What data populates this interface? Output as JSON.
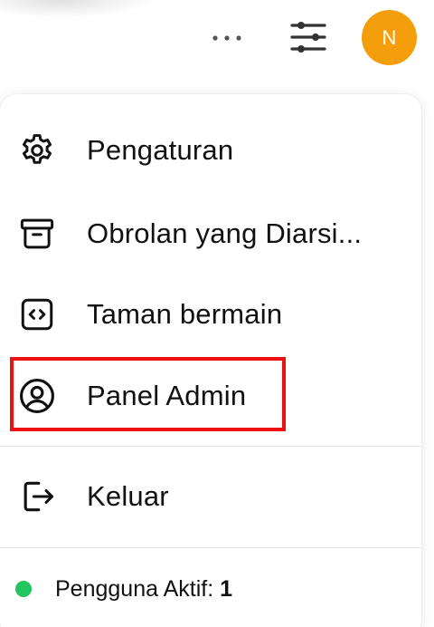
{
  "header": {
    "more_icon": "more-horizontal-icon",
    "filter_icon": "sliders-icon",
    "avatar_initial": "N",
    "avatar_color": "#f59e0b"
  },
  "menu": {
    "items": [
      {
        "label": "Pengaturan",
        "icon": "gear-icon"
      },
      {
        "label": "Obrolan yang Diarsi...",
        "icon": "archive-icon"
      },
      {
        "label": "Taman bermain",
        "icon": "code-icon"
      },
      {
        "label": "Panel Admin",
        "icon": "user-circle-icon"
      },
      {
        "label": "Keluar",
        "icon": "sign-out-icon"
      }
    ],
    "highlight_color": "#ee1111"
  },
  "status": {
    "label": "Pengguna Aktif:",
    "count": "1",
    "dot_color": "#22c55e"
  }
}
